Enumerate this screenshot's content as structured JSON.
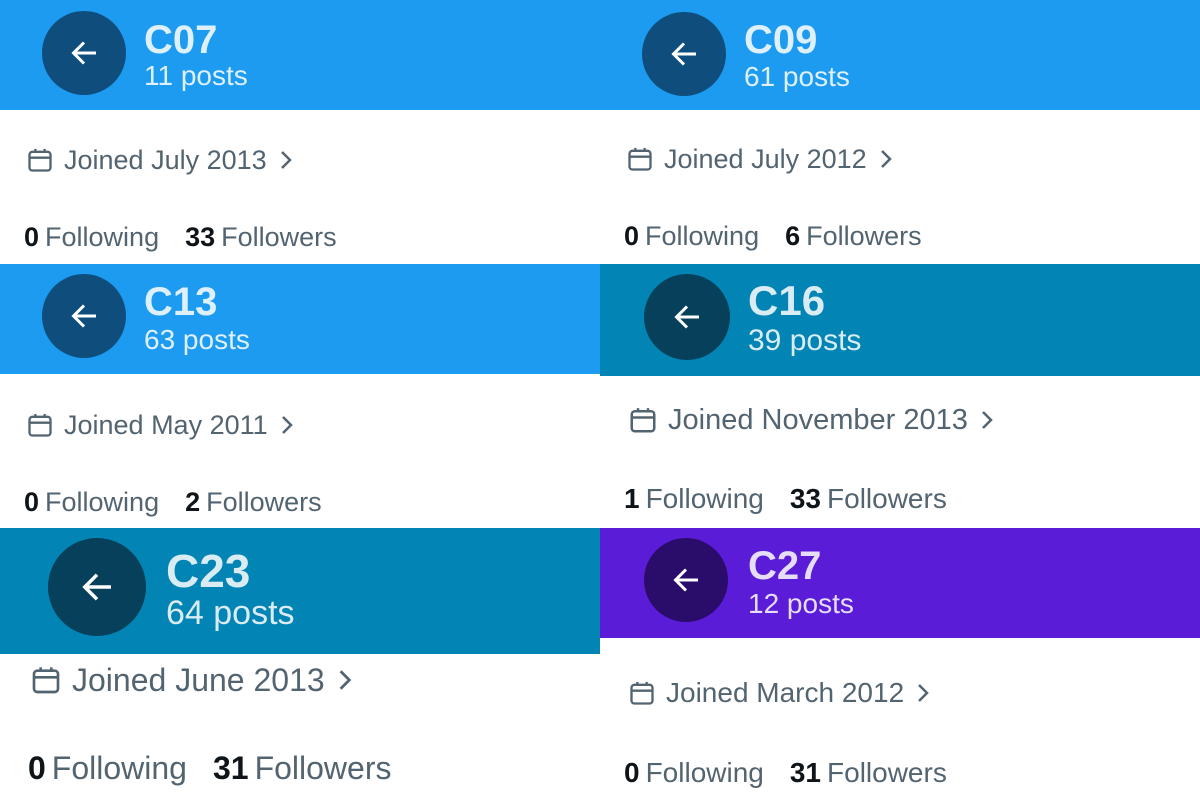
{
  "accounts": [
    {
      "name": "C07",
      "posts": "11 posts",
      "joined": "Joined July 2013",
      "following_count": "0",
      "following_label": "Following",
      "followers_count": "33",
      "followers_label": "Followers",
      "header_color": "#1d9bf0",
      "button_color": "#0f4e7c"
    },
    {
      "name": "C09",
      "posts": "61 posts",
      "joined": "Joined July 2012",
      "following_count": "0",
      "following_label": "Following",
      "followers_count": "6",
      "followers_label": "Followers",
      "header_color": "#1d9bf0",
      "button_color": "#0f4e7c"
    },
    {
      "name": "C13",
      "posts": "63 posts",
      "joined": "Joined May 2011",
      "following_count": "0",
      "following_label": "Following",
      "followers_count": "2",
      "followers_label": "Followers",
      "header_color": "#1d9bf0",
      "button_color": "#0f4e7c"
    },
    {
      "name": "C16",
      "posts": "39 posts",
      "joined": "Joined November 2013",
      "following_count": "1",
      "following_label": "Following",
      "followers_count": "33",
      "followers_label": "Followers",
      "header_color": "#0284b4",
      "button_color": "#06405a"
    },
    {
      "name": "C23",
      "posts": "64 posts",
      "joined": "Joined June 2013",
      "following_count": "0",
      "following_label": "Following",
      "followers_count": "31",
      "followers_label": "Followers",
      "header_color": "#0284b4",
      "button_color": "#06405a"
    },
    {
      "name": "C27",
      "posts": "12 posts",
      "joined": "Joined March 2012",
      "following_count": "0",
      "following_label": "Following",
      "followers_count": "31",
      "followers_label": "Followers",
      "header_color": "#5b1cd8",
      "button_color": "#2a0c6a"
    }
  ],
  "icons": {
    "back": "arrow-left-icon",
    "joined": "calendar-icon",
    "more": "chevron-right-icon"
  }
}
